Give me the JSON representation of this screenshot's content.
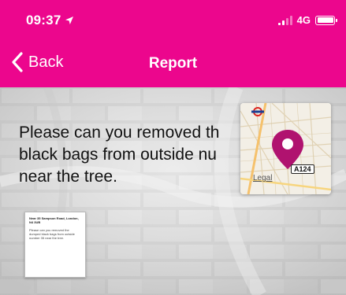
{
  "status_bar": {
    "time": "09:37",
    "network": "4G",
    "signal_bars_active": 2,
    "signal_bars_total": 4,
    "battery_level": 1.0,
    "icons": [
      "location-arrow-icon",
      "signal-icon",
      "battery-icon"
    ]
  },
  "nav": {
    "back_label": "Back",
    "title": "Report"
  },
  "report": {
    "text": "Please can you removed th\nblack bags from outside nu\nnear the tree."
  },
  "map": {
    "road_label": "A124",
    "legal": "Legal",
    "icons": [
      "map-pin-icon",
      "underground-roundel-icon"
    ]
  },
  "thumbnail": {
    "title": "Near 35 Sampson Road, London, N4 3UB",
    "body": "Please can you removed the dumped black bags from outside number 35 near the tree."
  },
  "colors": {
    "header": "#ec068d",
    "pin": "#b0126f",
    "text": "#111111"
  }
}
